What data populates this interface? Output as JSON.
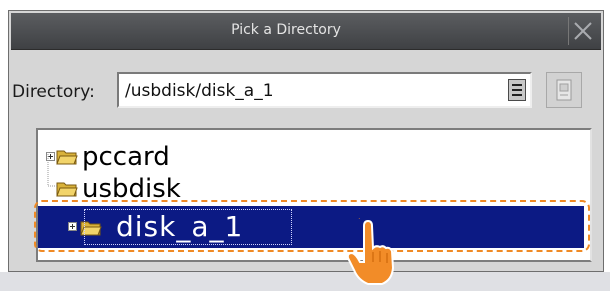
{
  "dialog": {
    "title": "Pick a Directory",
    "directory_label": "Directory:",
    "directory_value": "/usbdisk/disk_a_1"
  },
  "tree": {
    "items": [
      {
        "label": "pccard"
      },
      {
        "label": "usbdisk"
      },
      {
        "label": "disk_a_1",
        "selected": true
      }
    ]
  },
  "colors": {
    "titlebar": "#4b4d50",
    "selection": "#0c1a84",
    "highlight": "#f08a24",
    "folder": "#d9b23a"
  },
  "icons": {
    "close": "close-icon",
    "combo": "dropdown-icon",
    "new_folder": "new-folder-icon",
    "folder": "folder-icon",
    "pointer": "hand-pointer-icon"
  }
}
